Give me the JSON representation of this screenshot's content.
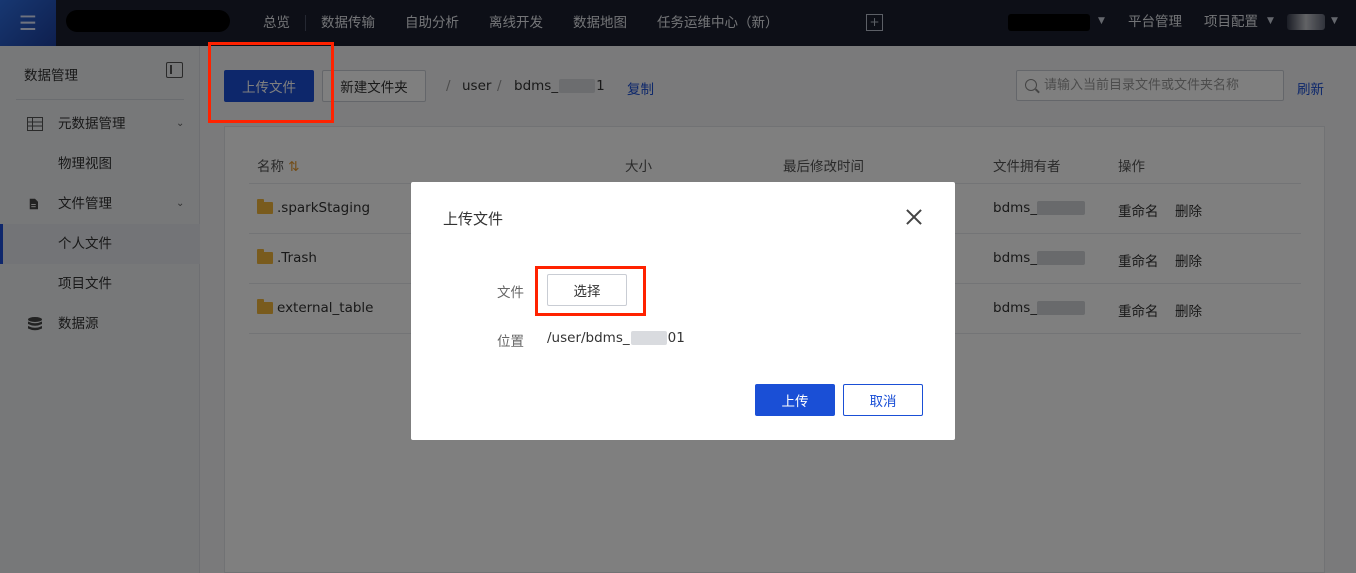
{
  "topbar": {
    "menu_icon": "menu-icon",
    "nav": [
      "总览",
      "数据传输",
      "自助分析",
      "离线开发",
      "数据地图",
      "任务运维中心（新）"
    ],
    "add_tab_icon": "+",
    "platform_manage": "平台管理",
    "project_config": "项目配置"
  },
  "sidebar": {
    "title": "数据管理",
    "items": [
      {
        "label": "元数据管理",
        "icon": "table-icon",
        "expandable": true
      },
      {
        "label": "物理视图"
      },
      {
        "label": "文件管理",
        "icon": "file-icon",
        "expandable": true
      },
      {
        "label": "个人文件",
        "active": true
      },
      {
        "label": "项目文件"
      },
      {
        "label": "数据源",
        "icon": "database-icon"
      }
    ]
  },
  "toolbar": {
    "upload_label": "上传文件",
    "new_folder_label": "新建文件夹",
    "path_sep": "/",
    "path_user": "user",
    "path_dir_prefix": "bdms_",
    "path_dir_suffix": "1",
    "copy_label": "复制",
    "search_placeholder": "请输入当前目录文件或文件夹名称",
    "refresh_label": "刷新"
  },
  "table": {
    "headers": {
      "name": "名称",
      "size": "大小",
      "modified": "最后修改时间",
      "owner": "文件拥有者",
      "actions": "操作"
    },
    "sort_icon": "⇅",
    "rows": [
      {
        "name": ".sparkStaging",
        "owner": "bdms_",
        "rename": "重命名",
        "delete": "删除"
      },
      {
        "name": ".Trash",
        "owner": "bdms_",
        "rename": "重命名",
        "delete": "删除"
      },
      {
        "name": "external_table",
        "owner": "bdms_",
        "rename": "重命名",
        "delete": "删除"
      }
    ]
  },
  "modal": {
    "title": "上传文件",
    "file_label": "文件",
    "choose_label": "选择",
    "location_label": "位置",
    "location_prefix": "/user/bdms_",
    "location_suffix": "01",
    "upload_label": "上传",
    "cancel_label": "取消"
  },
  "colors": {
    "primary": "#1a4fd6",
    "topbar": "#1b1f2e",
    "highlight": "#ff2200"
  }
}
